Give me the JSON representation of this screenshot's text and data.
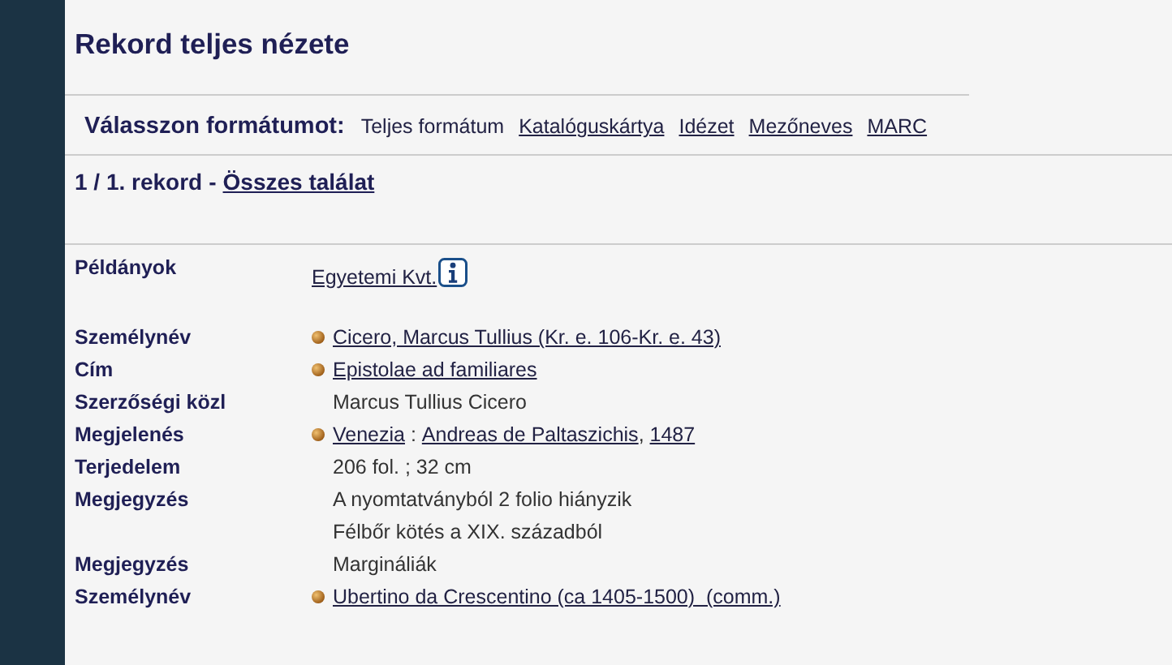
{
  "title": "Rekord teljes nézete",
  "format_bar": {
    "label": "Válasszon formátumot:",
    "formats": [
      {
        "label": "Teljes formátum",
        "selected": true
      },
      {
        "label": "Katalóguskártya",
        "selected": false
      },
      {
        "label": "Idézet",
        "selected": false
      },
      {
        "label": "Mezőneves",
        "selected": false
      },
      {
        "label": "MARC",
        "selected": false
      }
    ]
  },
  "record_nav": {
    "position": "1 / 1. rekord",
    "separator": "-",
    "link": "Összes találat"
  },
  "fields": [
    {
      "kind": "holdings",
      "label": "Példányok",
      "bullet": false,
      "lines": [
        [
          {
            "text": "Egyetemi Kvt.",
            "link": true
          }
        ]
      ]
    },
    {
      "kind": "field",
      "label": "Személynév",
      "bullet": true,
      "lines": [
        [
          {
            "text": "Cicero, Marcus Tullius (Kr. e. 106-Kr. e. 43)",
            "link": true
          }
        ]
      ]
    },
    {
      "kind": "field",
      "label": "Cím",
      "bullet": true,
      "lines": [
        [
          {
            "text": "Epistolae ad familiares",
            "link": true
          }
        ]
      ]
    },
    {
      "kind": "field",
      "label": "Szerzőségi közl",
      "bullet": false,
      "lines": [
        [
          {
            "text": "Marcus Tullius Cicero",
            "link": false
          }
        ]
      ]
    },
    {
      "kind": "field",
      "label": "Megjelenés",
      "bullet": true,
      "lines": [
        [
          {
            "text": "Venezia",
            "link": true
          },
          {
            "text": " : ",
            "link": false
          },
          {
            "text": "Andreas de Paltaszichis",
            "link": true
          },
          {
            "text": ", ",
            "link": false
          },
          {
            "text": "1487",
            "link": true
          }
        ]
      ]
    },
    {
      "kind": "field",
      "label": "Terjedelem",
      "bullet": false,
      "lines": [
        [
          {
            "text": "206 fol. ; 32 cm",
            "link": false
          }
        ]
      ]
    },
    {
      "kind": "field",
      "label": "Megjegyzés",
      "bullet": false,
      "lines": [
        [
          {
            "text": "A nyomtatványból 2 folio hiányzik",
            "link": false
          }
        ],
        [
          {
            "text": "Félbőr kötés a XIX. századból",
            "link": false
          }
        ]
      ]
    },
    {
      "kind": "field",
      "label": "Megjegyzés",
      "bullet": false,
      "lines": [
        [
          {
            "text": "Margináliák",
            "link": false
          }
        ]
      ]
    },
    {
      "kind": "field",
      "label": "Személynév",
      "bullet": true,
      "lines": [
        [
          {
            "text": "Ubertino da Crescentino (ca 1405-1500)  (comm.)",
            "link": true
          }
        ]
      ]
    }
  ]
}
